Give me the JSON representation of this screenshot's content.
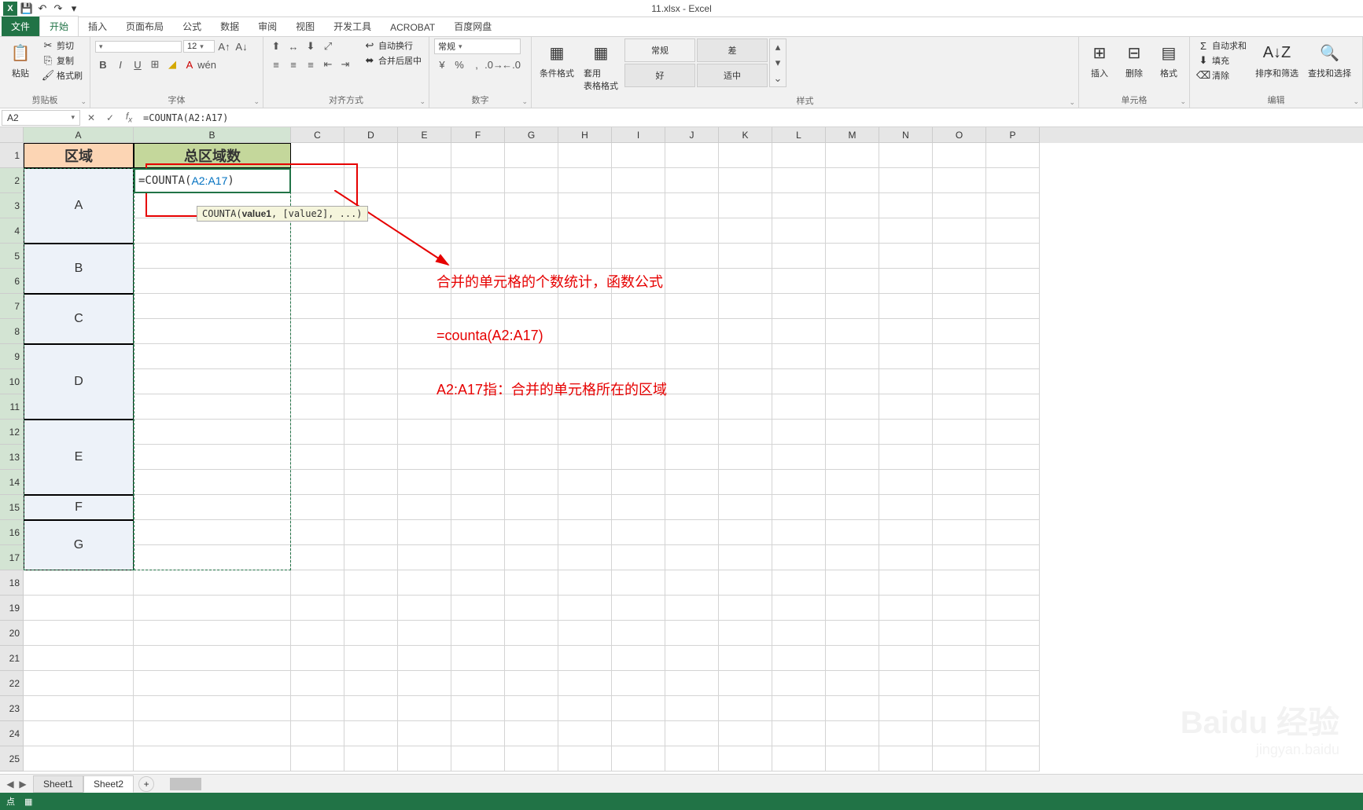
{
  "app": {
    "title": "11.xlsx - Excel"
  },
  "qat": {
    "save": "💾",
    "undo": "↶",
    "redo": "↷",
    "down": "▾"
  },
  "tabs": {
    "file": "文件",
    "home": "开始",
    "insert": "插入",
    "pageLayout": "页面布局",
    "formulas": "公式",
    "data": "数据",
    "review": "审阅",
    "view": "视图",
    "devtools": "开发工具",
    "acrobat": "ACROBAT",
    "baidu": "百度网盘"
  },
  "ribbon": {
    "clipboard": {
      "paste": "粘贴",
      "cut": "剪切",
      "copy": "复制",
      "formatPainter": "格式刷",
      "label": "剪贴板"
    },
    "font": {
      "fontName": "",
      "fontSize": "12",
      "label": "字体"
    },
    "alignment": {
      "wrap": "自动换行",
      "merge": "合并后居中",
      "label": "对齐方式"
    },
    "number": {
      "format": "常规",
      "label": "数字"
    },
    "styles": {
      "condFormat": "条件格式",
      "tableFormat": "套用\n表格格式",
      "normal": "常规",
      "bad": "差",
      "good": "好",
      "neutral": "适中",
      "label": "样式"
    },
    "cells": {
      "insert": "插入",
      "delete": "删除",
      "format": "格式",
      "label": "单元格"
    },
    "editing": {
      "autosum": "自动求和",
      "fill": "填充",
      "clear": "清除",
      "sortFilter": "排序和筛选",
      "findSelect": "查找和选择",
      "label": "编辑"
    }
  },
  "formulaBar": {
    "nameBox": "A2",
    "formula": "=COUNTA(A2:A17)"
  },
  "columns": [
    "A",
    "B",
    "C",
    "D",
    "E",
    "F",
    "G",
    "H",
    "I",
    "J",
    "K",
    "L",
    "M",
    "N",
    "O",
    "P"
  ],
  "colWidths": {
    "A": 140,
    "B": 200,
    "default": 68
  },
  "rowHeights": {
    "1": 32,
    "default": 32
  },
  "activeCell": "B2",
  "activeCol": [
    "A",
    "B"
  ],
  "activeRowRange": [
    2,
    17
  ],
  "headers": {
    "a1": "区域",
    "b1": "总区域数"
  },
  "mergedA": [
    {
      "rows": [
        2,
        4
      ],
      "text": "A"
    },
    {
      "rows": [
        5,
        6
      ],
      "text": "B"
    },
    {
      "rows": [
        7,
        8
      ],
      "text": "C"
    },
    {
      "rows": [
        9,
        11
      ],
      "text": "D"
    },
    {
      "rows": [
        12,
        14
      ],
      "text": "E"
    },
    {
      "rows": [
        15,
        15
      ],
      "text": "F"
    },
    {
      "rows": [
        16,
        17
      ],
      "text": "G"
    }
  ],
  "cellEdit": {
    "prefix": "=COUNTA(",
    "range": "A2:A17",
    "suffix": ")",
    "tooltip": "COUNTA(value1, [value2], ...)"
  },
  "annotations": {
    "line1": "合并的单元格的个数统计，函数公式",
    "line2": "=counta(A2:A17)",
    "line3": "A2:A17指：合并的单元格所在的区域"
  },
  "sheets": {
    "s1": "Sheet1",
    "s2": "Sheet2"
  },
  "status": {
    "mode": "点"
  },
  "watermark": {
    "main": "Baidu 经验",
    "sub": "jingyan.baidu"
  }
}
